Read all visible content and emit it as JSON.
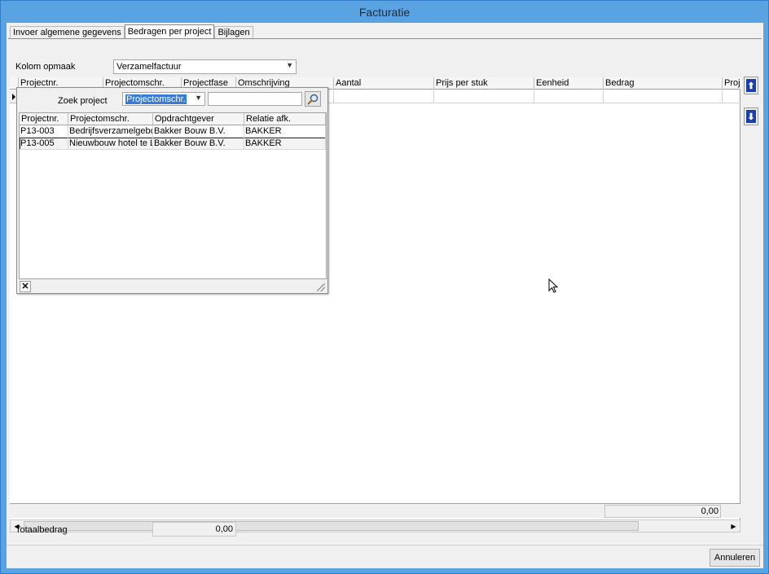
{
  "window": {
    "title": "Facturatie"
  },
  "tabs": [
    {
      "label": "Invoer algemene gegevens"
    },
    {
      "label": "Bedragen per project"
    },
    {
      "label": "Bijlagen"
    }
  ],
  "kolom": {
    "label": "Kolom opmaak",
    "value": "Verzamelfactuur"
  },
  "grid": {
    "columns": [
      "Projectnr.",
      "Projectomschr.",
      "Projectfase",
      "Omschrijving",
      "Aantal",
      "Prijs per stuk",
      "Eenheid",
      "Bedrag",
      "Proje"
    ],
    "footer_total": "0,00"
  },
  "popup": {
    "search_label": "Zoek project",
    "search_field": "Projectomschr.",
    "search_value": "",
    "columns": [
      "Projectnr.",
      "Projectomschr.",
      "Opdrachtgever",
      "Relatie afk."
    ],
    "rows": [
      {
        "nr": "P13-003",
        "omschr": "Bedrijfsverzamelgebouw",
        "opdrachtgever": "Bakker Bouw B.V.",
        "relatie": "BAKKER"
      },
      {
        "nr": "P13-005",
        "omschr": "Nieuwbouw hotel te Leusden",
        "opdrachtgever": "Bakker Bouw B.V.",
        "relatie": "BAKKER"
      }
    ],
    "close_glyph": "✕"
  },
  "totaal": {
    "label": "Totaalbedrag",
    "value": "0,00"
  },
  "buttons": {
    "annuleren": "Annuleren"
  },
  "side_buttons": {
    "up_glyph": "⬆",
    "down_glyph": "⬇"
  }
}
